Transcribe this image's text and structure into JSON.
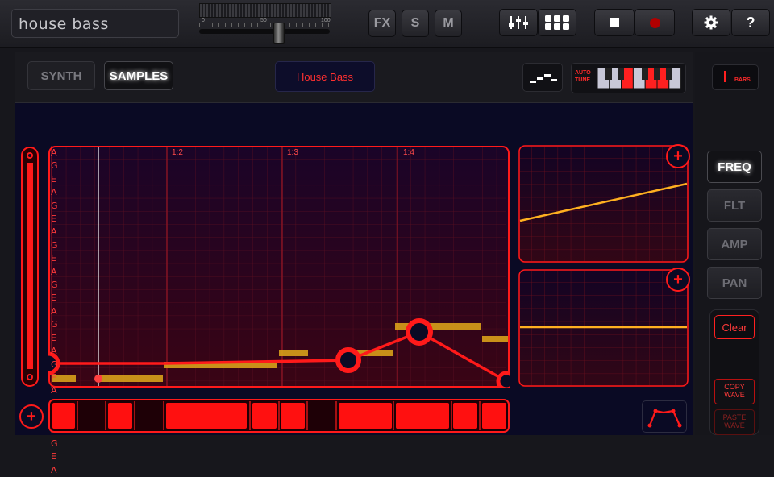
{
  "app": {
    "title": "house bass"
  },
  "master": {
    "scale_min": "0",
    "scale_mid": "50",
    "scale_max": "100"
  },
  "toolbar": {
    "fx_label": "FX",
    "solo_label": "S",
    "mute_label": "M",
    "settings_icon": "gear-icon",
    "help_label": "?"
  },
  "header": {
    "synth_tab": "SYNTH",
    "samples_tab": "SAMPLES",
    "preset_name": "House Bass",
    "autotune_label_1": "AUTO",
    "autotune_label_2": "TUNE",
    "bars_label": "BARS"
  },
  "roll": {
    "bar_markers": [
      "1:2",
      "1:3",
      "1:4"
    ],
    "note_labels": [
      "A",
      "G",
      "E",
      "A",
      "G",
      "E",
      "A",
      "G",
      "E",
      "A",
      "G",
      "E",
      "A",
      "G",
      "E",
      "A",
      "G",
      "E",
      "A",
      "G",
      "E",
      "A",
      "G",
      "E",
      "A"
    ]
  },
  "side_tabs": {
    "freq": "FREQ",
    "flt": "FLT",
    "amp": "AMP",
    "pan": "PAN"
  },
  "actions": {
    "clear": "Clear",
    "copy_1": "COPY",
    "copy_2": "WAVE",
    "paste_1": "PASTE",
    "paste_2": "WAVE"
  },
  "colors": {
    "accent_red": "#ff1a1a",
    "grid_red": "#7a0d1a",
    "note_gold": "#e8a21a",
    "bg_navy": "#0a0a24"
  }
}
